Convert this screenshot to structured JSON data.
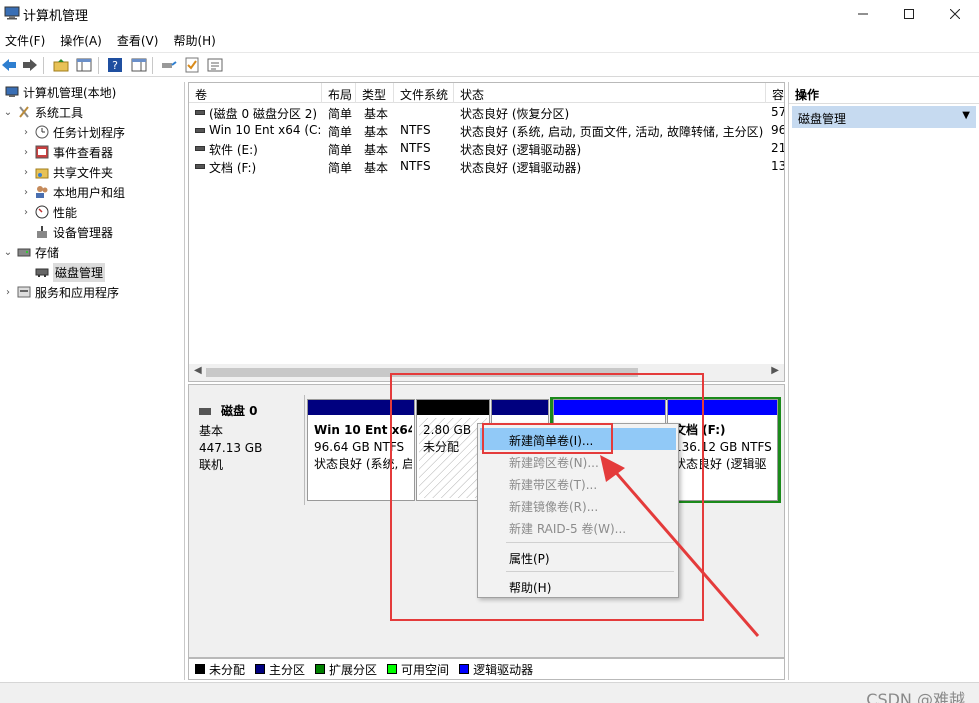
{
  "window": {
    "title": "计算机管理",
    "controls": [
      "minimize",
      "maximize",
      "close"
    ]
  },
  "menubar": [
    "文件(F)",
    "操作(A)",
    "查看(V)",
    "帮助(H)"
  ],
  "tree": {
    "root": "计算机管理(本地)",
    "system_tools": "系统工具",
    "task_scheduler": "任务计划程序",
    "event_viewer": "事件查看器",
    "shared_folders": "共享文件夹",
    "local_users": "本地用户和组",
    "performance": "性能",
    "device_manager": "设备管理器",
    "storage": "存储",
    "disk_management": "磁盘管理",
    "services": "服务和应用程序"
  },
  "volume_table": {
    "headers": [
      "卷",
      "布局",
      "类型",
      "文件系统",
      "状态",
      "容"
    ],
    "rows": [
      [
        "(磁盘 0 磁盘分区 2)",
        "简单",
        "基本",
        "",
        "状态良好 (恢复分区)",
        "57"
      ],
      [
        "Win 10 Ent x64 (C:)",
        "简单",
        "基本",
        "NTFS",
        "状态良好 (系统, 启动, 页面文件, 活动, 故障转储, 主分区)",
        "96"
      ],
      [
        "软件 (E:)",
        "简单",
        "基本",
        "NTFS",
        "状态良好 (逻辑驱动器)",
        "21"
      ],
      [
        "文档 (F:)",
        "简单",
        "基本",
        "NTFS",
        "状态良好 (逻辑驱动器)",
        "13"
      ]
    ]
  },
  "disk": {
    "name": "磁盘 0",
    "type": "基本",
    "size": "447.13 GB",
    "status": "联机"
  },
  "partitions": [
    {
      "title": "Win 10 Ent x64",
      "line2": "96.64 GB NTFS",
      "line3": "状态良好 (系统, 启",
      "color": "#00007f"
    },
    {
      "title": "",
      "line2": "2.80 GB",
      "line3": "未分配",
      "color": "#000000"
    },
    {
      "title": "",
      "line2": "",
      "line3": "",
      "color": "#00007f"
    },
    {
      "title": "",
      "line2": "",
      "line3": "",
      "color": "#0000ff"
    },
    {
      "title": "文档 (F:)",
      "line2": "136.12 GB NTFS",
      "line3": "状态良好 (逻辑驱",
      "color": "#0000ff"
    }
  ],
  "context_menu": {
    "items": [
      {
        "label": "新建简单卷(I)...",
        "enabled": true,
        "highlighted": true
      },
      {
        "label": "新建跨区卷(N)...",
        "enabled": false
      },
      {
        "label": "新建带区卷(T)...",
        "enabled": false
      },
      {
        "label": "新建镜像卷(R)...",
        "enabled": false
      },
      {
        "label": "新建 RAID-5 卷(W)...",
        "enabled": false
      },
      {
        "label": "属性(P)",
        "enabled": true
      },
      {
        "label": "帮助(H)",
        "enabled": true
      }
    ]
  },
  "legend": [
    {
      "label": "未分配",
      "color": "#000000"
    },
    {
      "label": "主分区",
      "color": "#00007f"
    },
    {
      "label": "扩展分区",
      "color": "#008000"
    },
    {
      "label": "可用空间",
      "color": "#00ff00"
    },
    {
      "label": "逻辑驱动器",
      "color": "#0000ff"
    }
  ],
  "actions": {
    "header": "操作",
    "selected": "磁盘管理"
  },
  "watermark": "CSDN @难越",
  "annotation_color": "#e43b3b"
}
